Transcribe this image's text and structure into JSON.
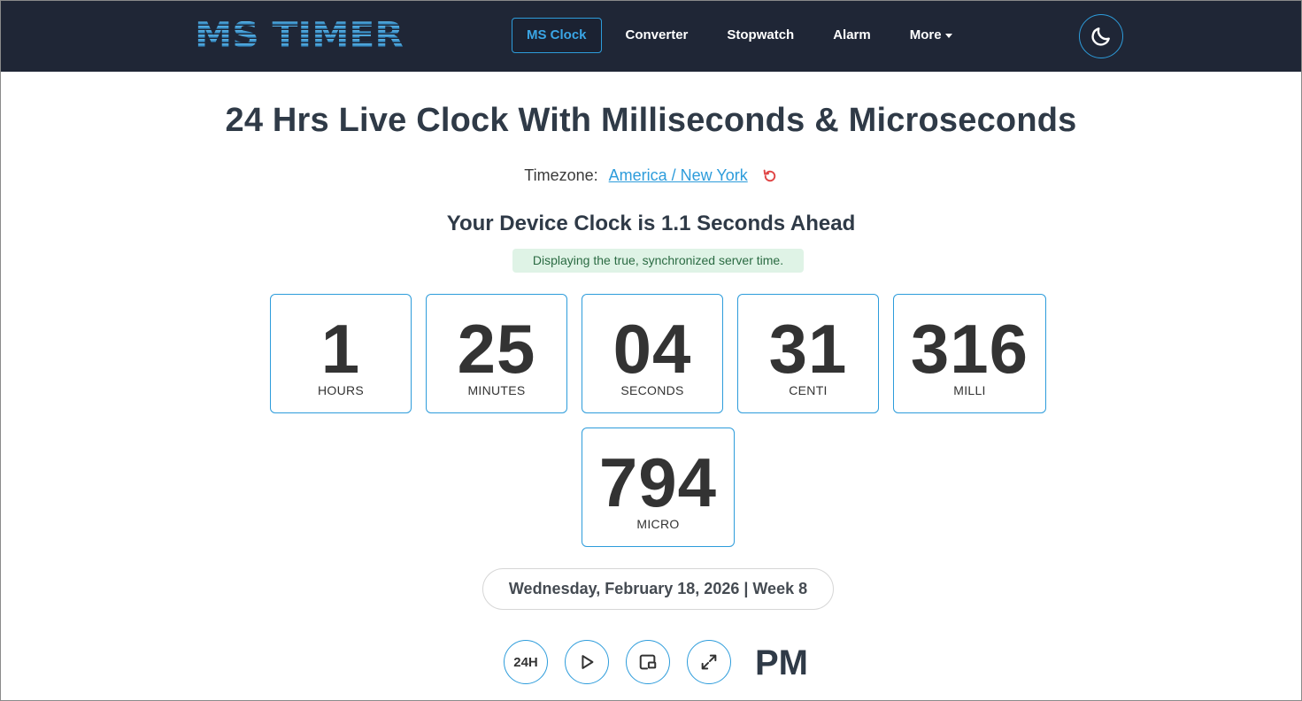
{
  "brand": {
    "logo_text": "MS TIMER"
  },
  "nav": {
    "items": [
      {
        "label": "MS Clock",
        "active": true
      },
      {
        "label": "Converter"
      },
      {
        "label": "Stopwatch"
      },
      {
        "label": "Alarm"
      },
      {
        "label": "More",
        "has_dropdown": true
      }
    ],
    "theme_toggle_icon": "moon-icon"
  },
  "page": {
    "title": "24 Hrs Live Clock With Milliseconds & Microseconds",
    "timezone_label": "Timezone:",
    "timezone_value": "America / New York",
    "offset_heading": "Your Device Clock is 1.1 Seconds Ahead",
    "sync_message": "Displaying the true, synchronized server time."
  },
  "clock": [
    {
      "value": "1",
      "label": "HOURS"
    },
    {
      "value": "25",
      "label": "MINUTES"
    },
    {
      "value": "04",
      "label": "SECONDS"
    },
    {
      "value": "31",
      "label": "CENTI"
    },
    {
      "value": "316",
      "label": "MILLI"
    },
    {
      "value": "794",
      "label": "MICRO"
    }
  ],
  "date_line": "Wednesday, February 18, 2026 | Week 8",
  "controls": {
    "format_label": "24H",
    "play_icon": "play-icon",
    "pip_icon": "picture-in-picture-icon",
    "fullscreen_icon": "expand-icon",
    "meridiem": "PM"
  },
  "colors": {
    "navbar_bg": "#1f2636",
    "accent": "#2d9cdb",
    "reset_icon": "#e04545",
    "badge_bg": "#dff3e6",
    "badge_text": "#2b6b43"
  }
}
